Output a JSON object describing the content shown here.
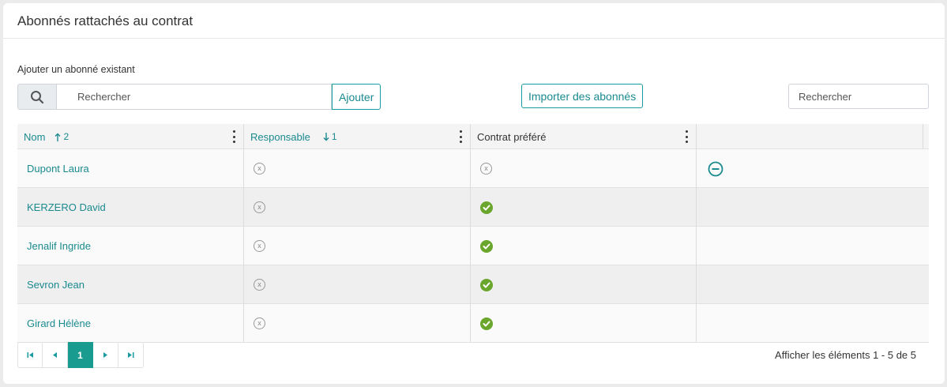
{
  "header": {
    "title": "Abonnés rattachés au contrat"
  },
  "add_section": {
    "label": "Ajouter un abonné existant",
    "search_placeholder": "Rechercher",
    "add_button": "Ajouter",
    "search_icon": "search-icon"
  },
  "import_button": "Importer des abonnés",
  "right_search": {
    "placeholder": "Rechercher"
  },
  "grid": {
    "columns": [
      {
        "label": "Nom",
        "sort_dir": "asc",
        "sort_order": "2"
      },
      {
        "label": "Responsable",
        "sort_dir": "desc",
        "sort_order": "1"
      },
      {
        "label": "Contrat préféré"
      },
      {
        "label": ""
      }
    ],
    "rows": [
      {
        "name": "Dupont Laura",
        "responsable": false,
        "prefere": false,
        "removable": true
      },
      {
        "name": "KERZERO David",
        "responsable": false,
        "prefere": true,
        "removable": false
      },
      {
        "name": "Jenalif Ingride",
        "responsable": false,
        "prefere": true,
        "removable": false
      },
      {
        "name": "Sevron Jean",
        "responsable": false,
        "prefere": true,
        "removable": false
      },
      {
        "name": "Girard Hélène",
        "responsable": false,
        "prefere": true,
        "removable": false
      }
    ]
  },
  "pager": {
    "current_page": "1",
    "info": "Afficher les éléments 1 - 5 de 5"
  },
  "colors": {
    "accent": "#1a8a8f",
    "active_page": "#1a9b8f",
    "check_green": "#6aa62c"
  }
}
